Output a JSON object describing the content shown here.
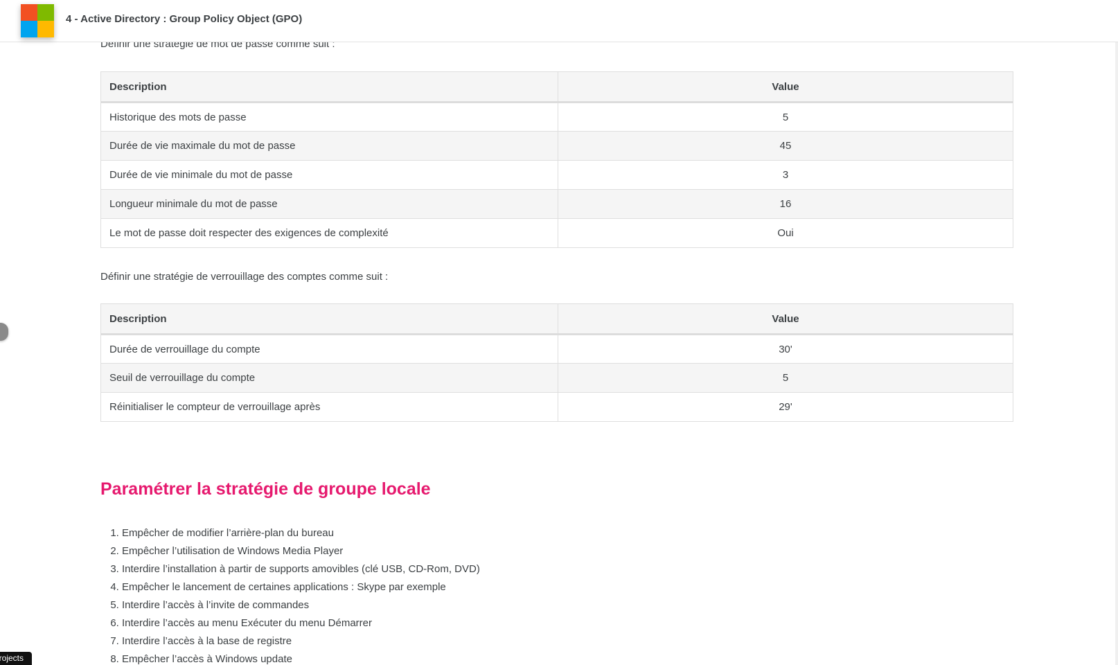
{
  "header": {
    "title": "4 - Active Directory : Group Policy Object (GPO)"
  },
  "intro_password": "Définir une stratégie de mot de passe comme suit :",
  "password_table": {
    "headers": [
      "Description",
      "Value"
    ],
    "rows": [
      {
        "description": "Historique des mots de passe",
        "value": "5"
      },
      {
        "description": "Durée de vie maximale du mot de passe",
        "value": "45"
      },
      {
        "description": "Durée de vie minimale du mot de passe",
        "value": "3"
      },
      {
        "description": "Longueur minimale du mot de passe",
        "value": "16"
      },
      {
        "description": "Le mot de passe doit respecter des exigences de complexité",
        "value": "Oui"
      }
    ]
  },
  "intro_lockout": "Définir une stratégie de verrouillage des comptes comme suit :",
  "lockout_table": {
    "headers": [
      "Description",
      "Value"
    ],
    "rows": [
      {
        "description": "Durée de verrouillage du compte",
        "value": "30'"
      },
      {
        "description": "Seuil de verrouillage du compte",
        "value": "5"
      },
      {
        "description": "Réinitialiser le compteur de verrouillage après",
        "value": "29'"
      }
    ]
  },
  "section_title": "Paramétrer la stratégie de groupe locale",
  "steps": [
    "Empêcher de modifier l’arrière-plan du bureau",
    "Empêcher l’utilisation de Windows Media Player",
    "Interdire l’installation à partir de supports amovibles (clé USB, CD-Rom, DVD)",
    "Empêcher le lancement de certaines applications : Skype par exemple",
    "Interdire l’accès à l’invite de commandes",
    "Interdire l’accès au menu Exécuter du menu Démarrer",
    "Interdire l’accès à la base de registre",
    "Empêcher l’accès à Windows update"
  ],
  "projects_tag": "projects",
  "colors": {
    "accent": "#e6196e",
    "text": "#3c4043",
    "table_header_bg": "#f5f5f5",
    "table_border": "#dedede"
  },
  "icons": {
    "logo": "microsoft-logo-icon"
  }
}
